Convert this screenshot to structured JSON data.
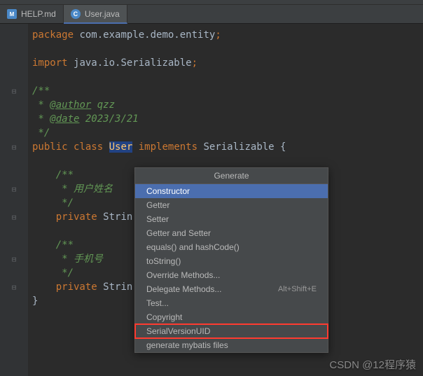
{
  "tabs": [
    {
      "label": "HELP.md",
      "icon": "M"
    },
    {
      "label": "User.java",
      "icon": "C"
    }
  ],
  "code": {
    "package_kw": "package ",
    "package_val": "com.example.demo.entity",
    "semicolon": ";",
    "import_kw": "import ",
    "import_val": "java.io.Serializable",
    "doc_open": "/**",
    "doc_star": " * ",
    "author_tag": "@author",
    "author_val": " qzz",
    "date_tag": "@date",
    "date_val": " 2023/3/21",
    "doc_close": " */",
    "public": "public ",
    "class": "class ",
    "classname": "User",
    "implements": " implements ",
    "iface": "Serializable",
    "brace_open": " {",
    "field1_doc": "用户姓名",
    "private": "private ",
    "string_type": "Strin",
    "field2_doc": "手机号",
    "brace_close": "}"
  },
  "popup": {
    "title": "Generate",
    "items": [
      {
        "label": "Constructor",
        "shortcut": "",
        "selected": true
      },
      {
        "label": "Getter",
        "shortcut": ""
      },
      {
        "label": "Setter",
        "shortcut": ""
      },
      {
        "label": "Getter and Setter",
        "shortcut": ""
      },
      {
        "label": "equals() and hashCode()",
        "shortcut": ""
      },
      {
        "label": "toString()",
        "shortcut": ""
      },
      {
        "label": "Override Methods...",
        "shortcut": ""
      },
      {
        "label": "Delegate Methods...",
        "shortcut": "Alt+Shift+E"
      },
      {
        "label": "Test...",
        "shortcut": ""
      },
      {
        "label": "Copyright",
        "shortcut": ""
      },
      {
        "label": "SerialVersionUID",
        "shortcut": "",
        "highlighted": true
      },
      {
        "label": "generate mybatis files",
        "shortcut": ""
      }
    ]
  },
  "watermark": "CSDN @12程序猿"
}
